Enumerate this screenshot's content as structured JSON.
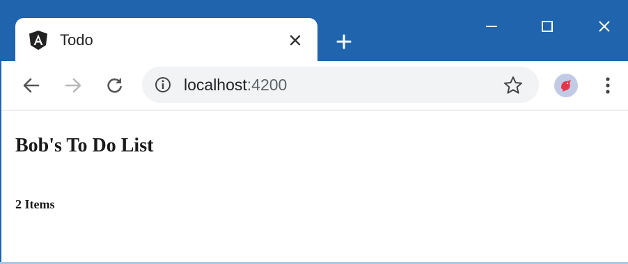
{
  "tab": {
    "title": "Todo",
    "favicon_icon": "angular-logo-icon",
    "close_icon": "close-icon"
  },
  "titlebar": {
    "new_tab_icon": "plus-icon",
    "window_controls": [
      "minimize-icon",
      "maximize-icon",
      "close-icon"
    ]
  },
  "toolbar": {
    "back_icon": "arrow-left-icon",
    "forward_icon": "arrow-right-icon",
    "reload_icon": "reload-icon",
    "address": {
      "info_icon": "info-icon",
      "host": "localhost",
      "port": ":4200"
    },
    "bookmark_icon": "star-icon",
    "profile_icon": "avatar-bird-icon",
    "menu_icon": "kebab-menu-icon"
  },
  "page": {
    "heading": "Bob's To Do List",
    "item_count": "2 Items"
  },
  "colors": {
    "title_bar": "#2064ae",
    "tab_background": "#ffffff",
    "omnibox_background": "#f1f3f4",
    "avatar_background": "#c2cbe6",
    "avatar_bird": "#e8344a",
    "text": "#1a1a1a"
  }
}
